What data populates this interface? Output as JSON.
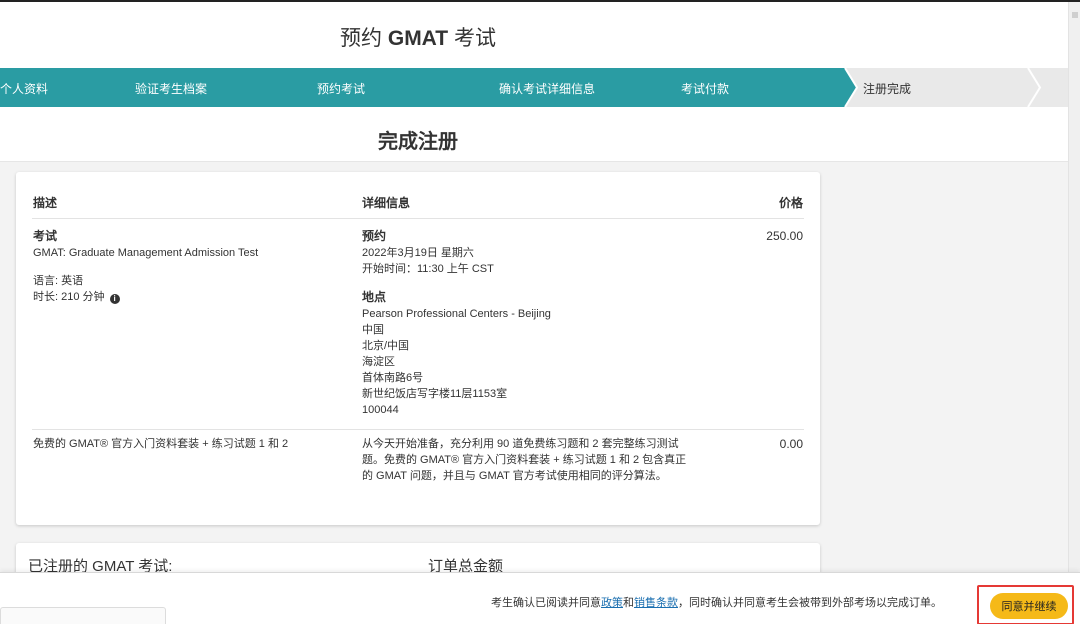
{
  "header": {
    "title_prefix": "预约",
    "title_brand": "GMAT",
    "title_suffix": "考试"
  },
  "stepper": {
    "steps": [
      {
        "label": "个人资料",
        "state": "done"
      },
      {
        "label": "验证考生档案",
        "state": "done"
      },
      {
        "label": "预约考试",
        "state": "done"
      },
      {
        "label": "确认考试详细信息",
        "state": "done"
      },
      {
        "label": "考试付款",
        "state": "done"
      },
      {
        "label": "注册完成",
        "state": "current"
      }
    ],
    "colors": {
      "done": "#2a9ca3",
      "pending": "#e9e9e9"
    }
  },
  "section": {
    "title": "完成注册"
  },
  "table": {
    "headers": {
      "description": "描述",
      "details": "详细信息",
      "price": "价格"
    },
    "exam": {
      "label": "考试",
      "name": "GMAT: Graduate Management Admission Test",
      "language": "语言: 英语",
      "duration": "时长: 210 分钟",
      "info_icon": "info-circle-icon",
      "appointment_label": "预约",
      "date": "2022年3月19日 星期六",
      "start_time": "开始时间：11:30 上午 CST",
      "location_label": "地点",
      "location_lines": [
        "Pearson Professional Centers - Beijing",
        "中国",
        "北京/中国",
        "海淀区",
        "首体南路6号",
        "新世纪饭店写字楼11层1153室",
        "100044"
      ],
      "price": "250.00"
    },
    "bundle": {
      "name": "免费的 GMAT® 官方入门资料套装 + 练习试题 1 和 2",
      "description": "从今天开始准备，充分利用 90 道免费练习题和 2 套完整练习测试题。免费的 GMAT® 官方入门资料套装 + 练习试题 1 和 2 包含真正的 GMAT 问题，并且与 GMAT 官方考试使用相同的评分算法。",
      "price": "0.00"
    }
  },
  "summary": {
    "registered_label": "已注册的 GMAT 考试:",
    "order_total_label": "订单总金额"
  },
  "footer": {
    "consent_prefix": "考生确认已阅读并同意",
    "policy_link": "政策",
    "consent_and": "和",
    "terms_link": "销售条款",
    "consent_suffix": "，同时确认并同意考生会被带到外部考场以完成订单。",
    "agree_button": "同意并继续",
    "button_color": "#f5b918",
    "highlight_color": "#e53935"
  }
}
